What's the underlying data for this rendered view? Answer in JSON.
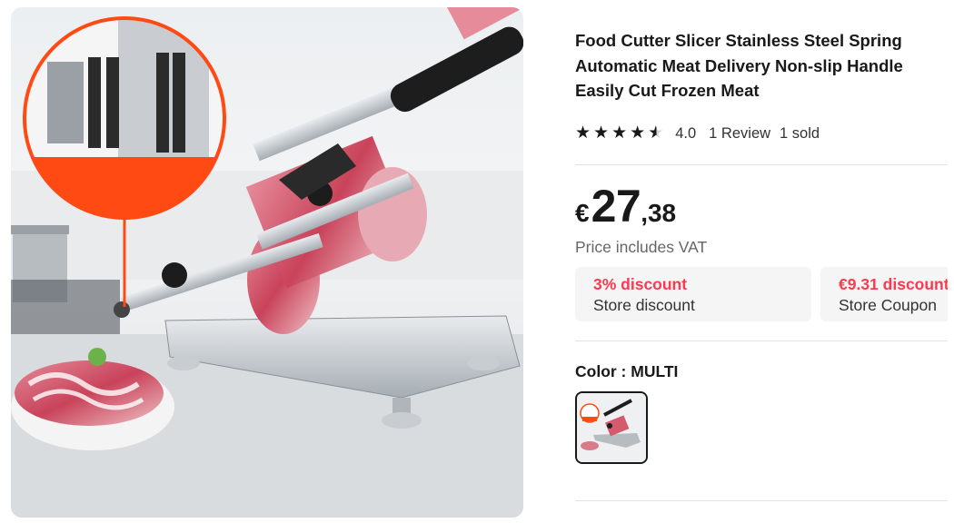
{
  "product": {
    "title": "Food Cutter Slicer Stainless Steel Spring Automatic Meat Delivery Non-slip Handle Easily Cut Frozen Meat",
    "image_alt": "meat-slicer-product-photo"
  },
  "rating": {
    "stars": 4.0,
    "star_display": [
      "full",
      "full",
      "full",
      "full",
      "half"
    ],
    "star_glyph": "★",
    "value": "4.0",
    "reviews": "1 Review",
    "sold": "1 sold"
  },
  "price": {
    "currency": "€",
    "integer": "27",
    "decimal": ",38",
    "vat_note": "Price includes VAT"
  },
  "discounts": [
    {
      "title": "3% discount",
      "subtitle": "Store discount"
    },
    {
      "title": "€9.31 discount",
      "subtitle": "Store Coupon"
    }
  ],
  "color": {
    "label": "Color : MULTI",
    "options": [
      {
        "name": "MULTI",
        "selected": true
      }
    ]
  },
  "theme": {
    "accent": "#fd384f",
    "text": "#191919",
    "muted": "#666666",
    "card_bg": "#f5f5f5",
    "callout_orange": "#ff4a14"
  }
}
